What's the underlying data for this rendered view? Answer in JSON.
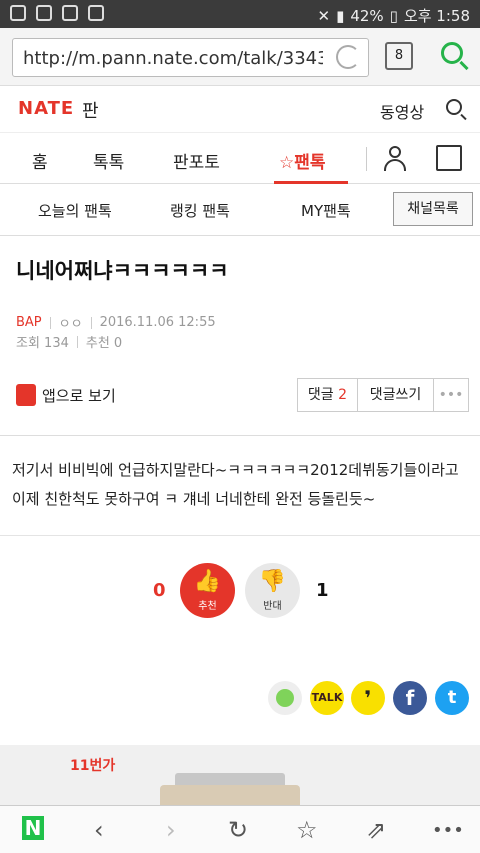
{
  "status_bar": {
    "battery": "42%",
    "time": "오후 1:58"
  },
  "browser": {
    "url": "http://m.pann.nate.com/talk/3343...",
    "tabs_count": "8"
  },
  "header": {
    "logo": "NATE",
    "service": "판",
    "video_link": "동영상"
  },
  "nav": {
    "items": [
      "홈",
      "톡톡",
      "판포토",
      "☆팬톡"
    ]
  },
  "subnav": {
    "items": [
      "오늘의 팬톡",
      "랭킹 팬톡",
      "MY팬톡"
    ],
    "channel_button": "채널목록"
  },
  "post": {
    "title": "니네어쩌냐ㅋㅋㅋㅋㅋㅋ",
    "author": "BAP",
    "author_sub": "ㅇㅇ",
    "date": "2016.11.06 12:55",
    "views": "조회 134",
    "recommend_label": "추천 0",
    "app_view": "앱으로 보기",
    "comments_label": "댓글",
    "comments_count": "2",
    "write_comment": "댓글쓰기",
    "more": "•••",
    "body": "저기서 비비빅에 언급하지말란다~ㅋㅋㅋㅋㅋㅋ2012데뷔동기들이라고 이제 친한척도 못하구여 ㅋ 걔네 너네한테 완전 등돌린듯~"
  },
  "votes": {
    "like_count": "0",
    "like_label": "추천",
    "dislike_label": "반대",
    "dislike_count": "1"
  },
  "share": {
    "talk": "TALK",
    "facebook": "f",
    "twitter": "t"
  },
  "ad": {
    "label": "11번가"
  },
  "colors": {
    "accent": "#e4352a",
    "naver_green": "#20c14a"
  }
}
